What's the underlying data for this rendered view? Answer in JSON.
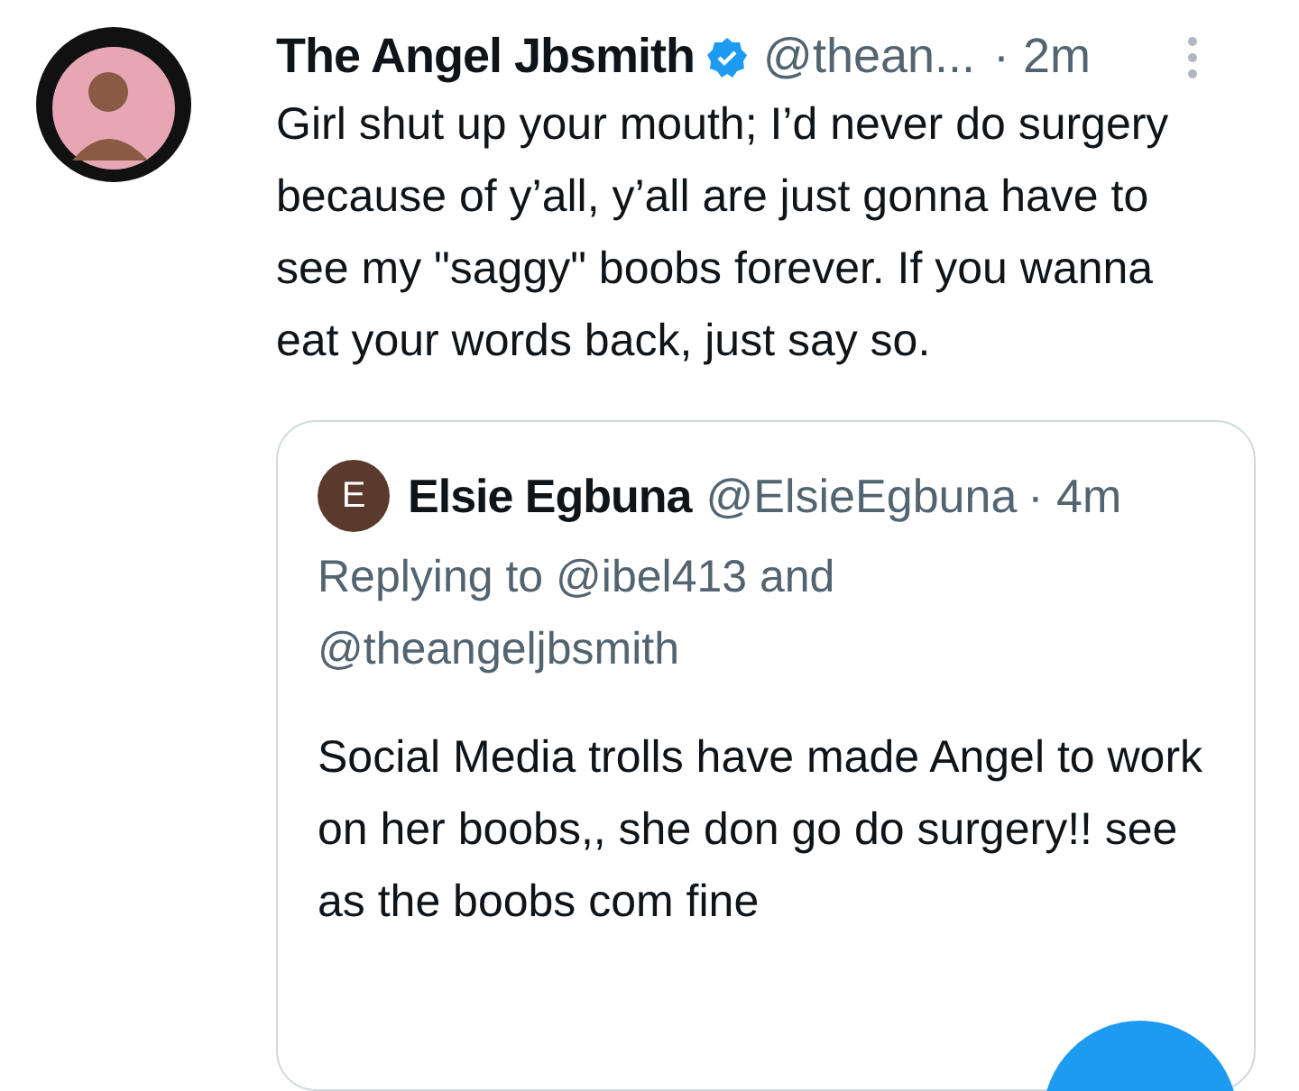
{
  "tweet": {
    "author": "The Angel Jbsmith",
    "verified": true,
    "handle": "@thean...",
    "time": "· 2m",
    "text": "Girl shut up your mouth; I’d never do surgery because of y’all, y’all are just gonna have to see my \"saggy\" boobs forever. If you wanna eat your words back, just say so.",
    "quoted": {
      "avatar_letter": "E",
      "author": "Elsie Egbuna",
      "handle": "@ElsieEgbuna",
      "time": "· 4m",
      "replying": "Replying to @ibel413 and @theangeljbsmith",
      "text": "Social Media trolls have made Angel to work on her boobs,, she don go do surgery!! see as the boobs com fine"
    }
  }
}
